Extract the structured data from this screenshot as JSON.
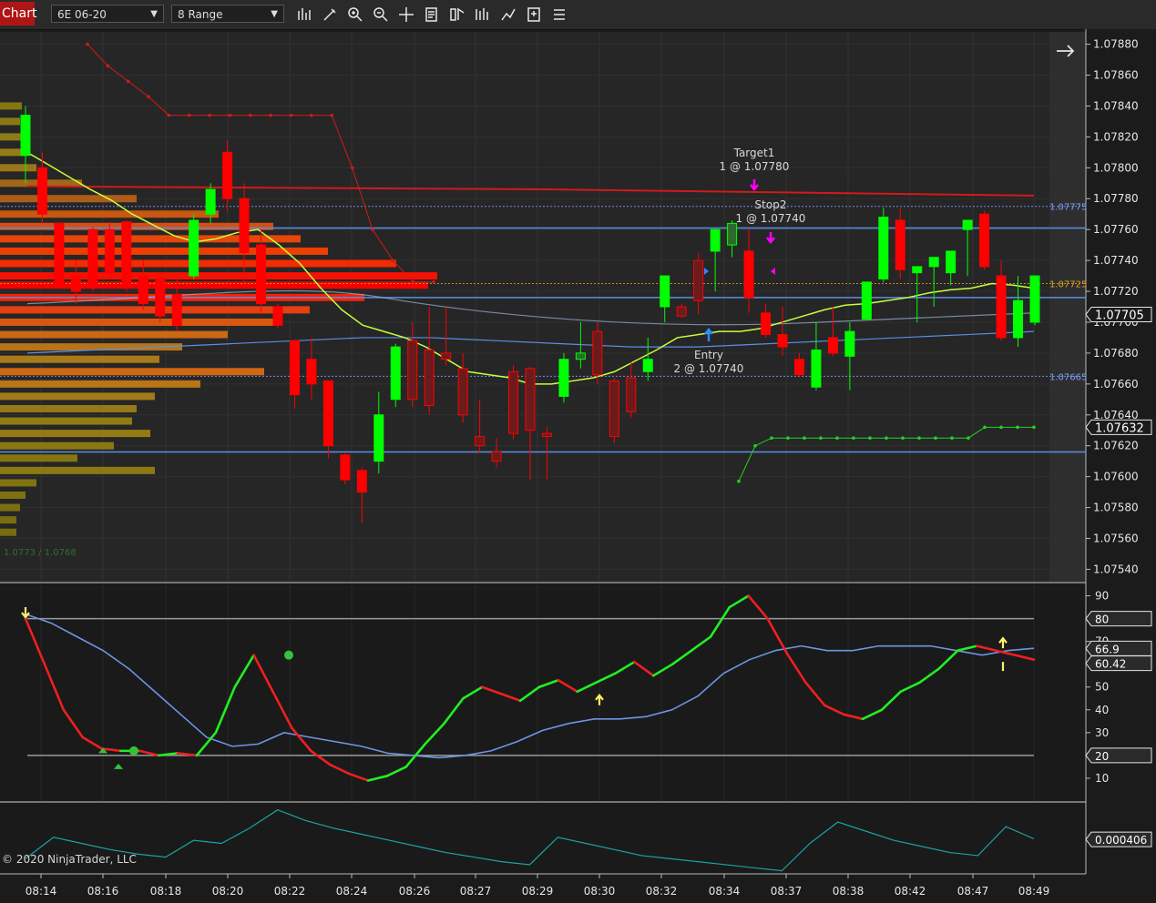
{
  "toolbar": {
    "tab_label": "Chart",
    "instrument": "6E 06-20",
    "interval": "8 Range",
    "tool_icons": [
      "bar-style-icon",
      "draw-tool-icon",
      "zoom-in-icon",
      "zoom-out-icon",
      "crosshair-icon",
      "data-box-icon",
      "strategies-icon",
      "indicators-icon",
      "drawing-objects-icon",
      "templates-icon",
      "properties-icon"
    ]
  },
  "colors": {
    "background": "#262626",
    "panel_border": "#cfcfcf",
    "up_candle": "#00ff00",
    "down_candle": "#ff0000",
    "sma_yellow": "#c8ff3c",
    "blue_line": "#5b8ee6",
    "red_line": "#d21a1a",
    "green_stop": "#1fd61f",
    "magenta_marker": "#ff00ff",
    "teal_line": "#1aa3a3"
  },
  "price_panel": {
    "axis_ticks": [
      "1.07880",
      "1.07860",
      "1.07840",
      "1.07820",
      "1.07800",
      "1.07780",
      "1.07760",
      "1.07740",
      "1.07720",
      "1.07700",
      "1.07680",
      "1.07660",
      "1.07640",
      "1.07620",
      "1.07600",
      "1.07580",
      "1.07560",
      "1.07540"
    ],
    "price_badges": [
      {
        "text": "1.07705",
        "value": 1.07705
      },
      {
        "text": "1.07632",
        "value": 1.07632
      }
    ],
    "line_labels": [
      {
        "text": "1.07775",
        "value": 1.07775,
        "color": "#7f9fff"
      },
      {
        "text": "1.07725",
        "value": 1.07725,
        "color": "#e0a020"
      },
      {
        "text": "1.07665",
        "value": 1.07665,
        "color": "#7f9fff"
      }
    ],
    "annotations": [
      {
        "line1": "Target1",
        "line2": "1 @ 1.07780"
      },
      {
        "line1": "Stop2",
        "line2": "1 @ 1.07740"
      },
      {
        "line1": "Entry",
        "line2": "2 @ 1.07740"
      }
    ],
    "profile_text": "1.0773 / 1.0768",
    "candles": [
      {
        "o": 1.07808,
        "h": 1.0784,
        "l": 1.0779,
        "c": 1.07834
      },
      {
        "o": 1.078,
        "h": 1.0781,
        "l": 1.07764,
        "c": 1.0777
      },
      {
        "o": 1.07764,
        "h": 1.07765,
        "l": 1.07724,
        "c": 1.07724
      },
      {
        "o": 1.0773,
        "h": 1.0774,
        "l": 1.07712,
        "c": 1.0772
      },
      {
        "o": 1.0776,
        "h": 1.07762,
        "l": 1.0772,
        "c": 1.07724
      },
      {
        "o": 1.0776,
        "h": 1.07765,
        "l": 1.07728,
        "c": 1.07732
      },
      {
        "o": 1.07765,
        "h": 1.07766,
        "l": 1.0772,
        "c": 1.07724
      },
      {
        "o": 1.0773,
        "h": 1.0774,
        "l": 1.07708,
        "c": 1.07712
      },
      {
        "o": 1.07728,
        "h": 1.0773,
        "l": 1.077,
        "c": 1.07704
      },
      {
        "o": 1.07718,
        "h": 1.0773,
        "l": 1.07694,
        "c": 1.07698
      },
      {
        "o": 1.0773,
        "h": 1.0777,
        "l": 1.07728,
        "c": 1.07766
      },
      {
        "o": 1.0777,
        "h": 1.0779,
        "l": 1.07764,
        "c": 1.07786
      },
      {
        "o": 1.0781,
        "h": 1.07818,
        "l": 1.07772,
        "c": 1.0778
      },
      {
        "o": 1.0778,
        "h": 1.0779,
        "l": 1.07725,
        "c": 1.07745
      },
      {
        "o": 1.0775,
        "h": 1.0776,
        "l": 1.07705,
        "c": 1.07712
      },
      {
        "o": 1.0771,
        "h": 1.07712,
        "l": 1.07696,
        "c": 1.07698
      },
      {
        "o": 1.07688,
        "h": 1.07688,
        "l": 1.07644,
        "c": 1.07653
      },
      {
        "o": 1.07676,
        "h": 1.0769,
        "l": 1.0765,
        "c": 1.0766
      },
      {
        "o": 1.07662,
        "h": 1.07662,
        "l": 1.07612,
        "c": 1.0762
      },
      {
        "o": 1.07614,
        "h": 1.07615,
        "l": 1.07595,
        "c": 1.07598
      },
      {
        "o": 1.07604,
        "h": 1.07606,
        "l": 1.0757,
        "c": 1.0759
      },
      {
        "o": 1.0761,
        "h": 1.07655,
        "l": 1.07602,
        "c": 1.0764
      },
      {
        "o": 1.0765,
        "h": 1.07686,
        "l": 1.07645,
        "c": 1.07684
      },
      {
        "o": 1.07688,
        "h": 1.077,
        "l": 1.07645,
        "c": 1.0765
      },
      {
        "o": 1.07682,
        "h": 1.0771,
        "l": 1.0764,
        "c": 1.07646
      },
      {
        "o": 1.0768,
        "h": 1.0771,
        "l": 1.07672,
        "c": 1.07676
      },
      {
        "o": 1.0767,
        "h": 1.0768,
        "l": 1.07635,
        "c": 1.0764
      },
      {
        "o": 1.07626,
        "h": 1.0765,
        "l": 1.07615,
        "c": 1.0762
      },
      {
        "o": 1.07616,
        "h": 1.07625,
        "l": 1.07606,
        "c": 1.0761
      },
      {
        "o": 1.07668,
        "h": 1.07672,
        "l": 1.07624,
        "c": 1.07628
      },
      {
        "o": 1.0767,
        "h": 1.07671,
        "l": 1.07598,
        "c": 1.0763
      },
      {
        "o": 1.07628,
        "h": 1.07632,
        "l": 1.07598,
        "c": 1.07626
      },
      {
        "o": 1.07652,
        "h": 1.0768,
        "l": 1.07648,
        "c": 1.07676
      },
      {
        "o": 1.07676,
        "h": 1.077,
        "l": 1.0767,
        "c": 1.0768
      },
      {
        "o": 1.07694,
        "h": 1.077,
        "l": 1.0766,
        "c": 1.07666
      },
      {
        "o": 1.07662,
        "h": 1.07664,
        "l": 1.07622,
        "c": 1.07626
      },
      {
        "o": 1.07664,
        "h": 1.07674,
        "l": 1.07638,
        "c": 1.07642
      },
      {
        "o": 1.07668,
        "h": 1.0769,
        "l": 1.07662,
        "c": 1.07676
      },
      {
        "o": 1.0771,
        "h": 1.0773,
        "l": 1.077,
        "c": 1.0773
      },
      {
        "o": 1.0771,
        "h": 1.07712,
        "l": 1.07703,
        "c": 1.07704
      },
      {
        "o": 1.0774,
        "h": 1.07745,
        "l": 1.07705,
        "c": 1.07714
      },
      {
        "o": 1.07746,
        "h": 1.0776,
        "l": 1.0772,
        "c": 1.0776
      },
      {
        "o": 1.0775,
        "h": 1.07766,
        "l": 1.07742,
        "c": 1.07764
      },
      {
        "o": 1.07746,
        "h": 1.0776,
        "l": 1.07706,
        "c": 1.07716
      },
      {
        "o": 1.07706,
        "h": 1.07712,
        "l": 1.0769,
        "c": 1.07692
      },
      {
        "o": 1.07692,
        "h": 1.0771,
        "l": 1.07678,
        "c": 1.07684
      },
      {
        "o": 1.07676,
        "h": 1.0768,
        "l": 1.07665,
        "c": 1.07666
      },
      {
        "o": 1.07658,
        "h": 1.077,
        "l": 1.07656,
        "c": 1.07682
      },
      {
        "o": 1.0769,
        "h": 1.0771,
        "l": 1.07678,
        "c": 1.0768
      },
      {
        "o": 1.07678,
        "h": 1.077,
        "l": 1.07656,
        "c": 1.07694
      },
      {
        "o": 1.07702,
        "h": 1.07726,
        "l": 1.07702,
        "c": 1.07726
      },
      {
        "o": 1.07728,
        "h": 1.07774,
        "l": 1.07726,
        "c": 1.07768
      },
      {
        "o": 1.07766,
        "h": 1.07774,
        "l": 1.07728,
        "c": 1.07734
      },
      {
        "o": 1.07732,
        "h": 1.07736,
        "l": 1.077,
        "c": 1.07736
      },
      {
        "o": 1.07736,
        "h": 1.0774,
        "l": 1.0771,
        "c": 1.07742
      },
      {
        "o": 1.07732,
        "h": 1.07746,
        "l": 1.07724,
        "c": 1.07746
      },
      {
        "o": 1.0776,
        "h": 1.07764,
        "l": 1.0773,
        "c": 1.07766
      },
      {
        "o": 1.0777,
        "h": 1.07772,
        "l": 1.07734,
        "c": 1.07736
      },
      {
        "o": 1.0773,
        "h": 1.0774,
        "l": 1.07688,
        "c": 1.0769
      },
      {
        "o": 1.0769,
        "h": 1.0773,
        "l": 1.07684,
        "c": 1.07714
      },
      {
        "o": 1.077,
        "h": 1.07712,
        "l": 1.07698,
        "c": 1.0773
      }
    ],
    "sma_yellow": [
      1.0781,
      1.07802,
      1.07794,
      1.07786,
      1.07779,
      1.0777,
      1.07763,
      1.07756,
      1.07752,
      1.07754,
      1.07758,
      1.0776,
      1.0775,
      1.07738,
      1.07722,
      1.07708,
      1.07698,
      1.07694,
      1.0769,
      1.07684,
      1.07676,
      1.07668,
      1.07666,
      1.07664,
      1.0766,
      1.0766,
      1.07662,
      1.07664,
      1.07668,
      1.07675,
      1.07682,
      1.0769,
      1.07692,
      1.07694,
      1.07694,
      1.07696,
      1.077,
      1.07704,
      1.07708,
      1.07711,
      1.07712,
      1.07714,
      1.07716,
      1.07719,
      1.07721,
      1.07722,
      1.07725,
      1.07724,
      1.07722
    ],
    "blue_line": [
      1.0768,
      1.07682,
      1.07684,
      1.07686,
      1.07688,
      1.0769,
      1.0769,
      1.07688,
      1.07686,
      1.07684,
      1.07684,
      1.07686,
      1.07688,
      1.0769,
      1.07692,
      1.07694
    ],
    "red_trail": [
      1.0788,
      1.07866,
      1.07856,
      1.07846,
      1.07834,
      1.07834,
      1.07834,
      1.07834,
      1.07834,
      1.07834,
      1.07834,
      1.07834,
      1.07834,
      1.078,
      1.0776,
      1.0774,
      1.07726,
      1.07726
    ],
    "green_trail": [
      1.07597,
      1.0762,
      1.07625,
      1.07625,
      1.07625,
      1.07625,
      1.07625,
      1.07625,
      1.07625,
      1.07625,
      1.07625,
      1.07625,
      1.07625,
      1.07625,
      1.07625,
      1.07632,
      1.07632,
      1.07632,
      1.07632
    ]
  },
  "osc_panel": {
    "axis_ticks": [
      "90",
      "80",
      "70",
      "60",
      "50",
      "40",
      "30",
      "20",
      "10"
    ],
    "badges": [
      {
        "text": "80",
        "value": 80
      },
      {
        "text": "66.9",
        "value": 66.9
      },
      {
        "text": "60.42",
        "value": 60.42
      },
      {
        "text": "20",
        "value": 20
      }
    ],
    "upper_level": 80,
    "lower_level": 20,
    "fast_line": [
      80,
      60,
      40,
      28,
      23,
      22,
      22,
      20,
      21,
      20,
      30,
      50,
      64,
      48,
      32,
      22,
      16,
      12,
      9,
      11,
      15,
      25,
      34,
      45,
      50,
      47,
      44,
      50,
      53,
      48,
      52,
      56,
      61,
      55,
      60,
      66,
      72,
      85,
      90,
      80,
      65,
      52,
      42,
      38,
      36,
      40,
      48,
      52,
      58,
      66,
      68,
      66,
      64,
      62
    ],
    "slow_line": [
      82,
      78,
      72,
      66,
      58,
      48,
      38,
      28,
      24,
      25,
      30,
      28,
      26,
      24,
      21,
      20,
      19,
      20,
      22,
      26,
      31,
      34,
      36,
      36,
      37,
      40,
      46,
      56,
      62,
      66,
      68,
      66,
      66,
      68,
      68,
      68,
      66,
      64,
      66,
      67
    ]
  },
  "vol_panel": {
    "badge": "0.000406",
    "copyright": "© 2020 NinjaTrader, LLC",
    "line": [
      0.00028,
      0.00042,
      0.00038,
      0.00034,
      0.00031,
      0.00029,
      0.0004,
      0.00038,
      0.00048,
      0.0006,
      0.00053,
      0.00048,
      0.00044,
      0.0004,
      0.00036,
      0.00032,
      0.00029,
      0.00026,
      0.00024,
      0.00042,
      0.00038,
      0.00034,
      0.0003,
      0.00028,
      0.00026,
      0.00024,
      0.00022,
      0.0002,
      0.00038,
      0.00052,
      0.00046,
      0.0004,
      0.00036,
      0.00032,
      0.0003,
      0.00049,
      0.00041
    ]
  },
  "time_axis": [
    "08:14",
    "08:16",
    "08:18",
    "08:20",
    "08:22",
    "08:24",
    "08:26",
    "08:27",
    "08:29",
    "08:30",
    "08:32",
    "08:34",
    "08:37",
    "08:38",
    "08:42",
    "08:47",
    "08:49"
  ]
}
